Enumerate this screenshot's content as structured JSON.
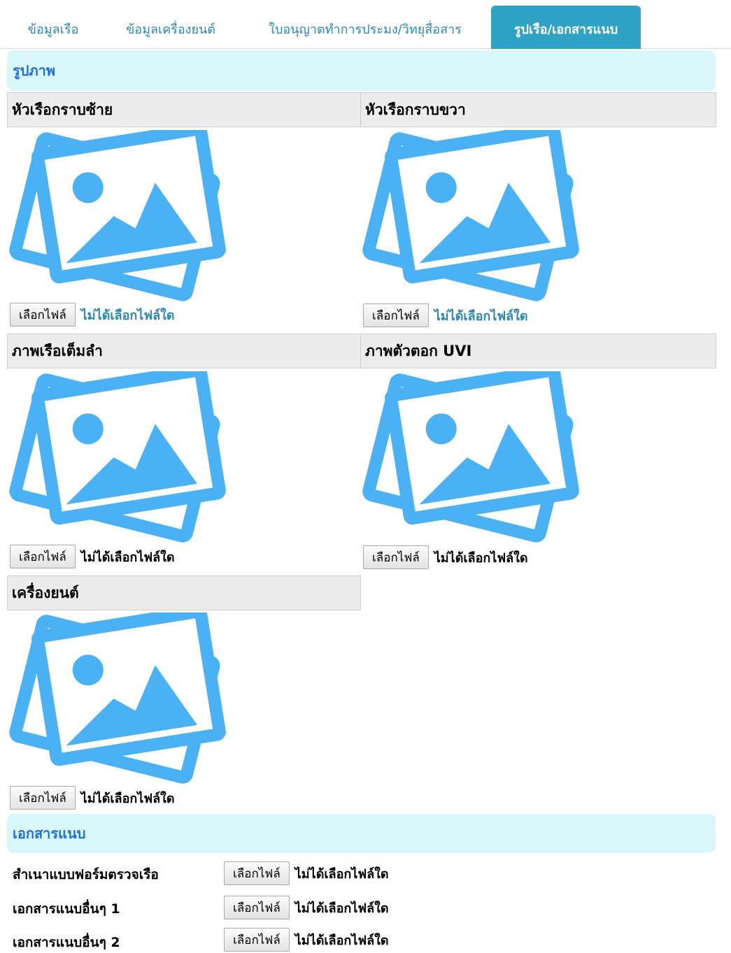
{
  "tabs": [
    {
      "label": "ข้อมูลเรือ",
      "active": false
    },
    {
      "label": "ข้อมูลเครื่องยนต์",
      "active": false
    },
    {
      "label": "ใบอนุญาตทำการประมง/วิทยุสื่อสาร",
      "active": false
    },
    {
      "label": "รูปเรือ/เอกสารแนบ",
      "active": true
    }
  ],
  "photos": {
    "section_title": "รูปภาพ",
    "items": [
      {
        "label": "หัวเรือกราบซ้าย",
        "icon": "image-placeholder-icon",
        "button": "เลือกไฟล์",
        "status": "ไม่ได้เลือกไฟล์ใด"
      },
      {
        "label": "หัวเรือกราบขวา",
        "icon": "image-placeholder-icon",
        "button": "เลือกไฟล์",
        "status": "ไม่ได้เลือกไฟล์ใด"
      },
      {
        "label": "ภาพเรือเต็มลำ",
        "icon": "image-placeholder-icon",
        "button": "เลือกไฟล์",
        "status": "ไม่ได้เลือกไฟล์ใด"
      },
      {
        "label": "ภาพตัวตอก UVI",
        "icon": "image-placeholder-icon",
        "button": "เลือกไฟล์",
        "status": "ไม่ได้เลือกไฟล์ใด"
      },
      {
        "label": "เครื่องยนต์",
        "icon": "image-placeholder-icon",
        "button": "เลือกไฟล์",
        "status": "ไม่ได้เลือกไฟล์ใด"
      }
    ]
  },
  "attachments": {
    "section_title": "เอกสารแนบ",
    "items": [
      {
        "label": "สำเนาแบบฟอร์มตรวจเรือ",
        "button": "เลือกไฟล์",
        "status": "ไม่ได้เลือกไฟล์ใด"
      },
      {
        "label": "เอกสารแนบอื่นๆ 1",
        "button": "เลือกไฟล์",
        "status": "ไม่ได้เลือกไฟล์ใด"
      },
      {
        "label": "เอกสารแนบอื่นๆ 2",
        "button": "เลือกไฟล์",
        "status": "ไม่ได้เลือกไฟล์ใด"
      }
    ]
  },
  "colors": {
    "tab_text": "#2b87b3",
    "tab_active_bg": "#2ea3c6",
    "section_bg": "#d9f6fb",
    "section_title": "#1e6fd9",
    "icon_blue": "#4bb1f5"
  }
}
